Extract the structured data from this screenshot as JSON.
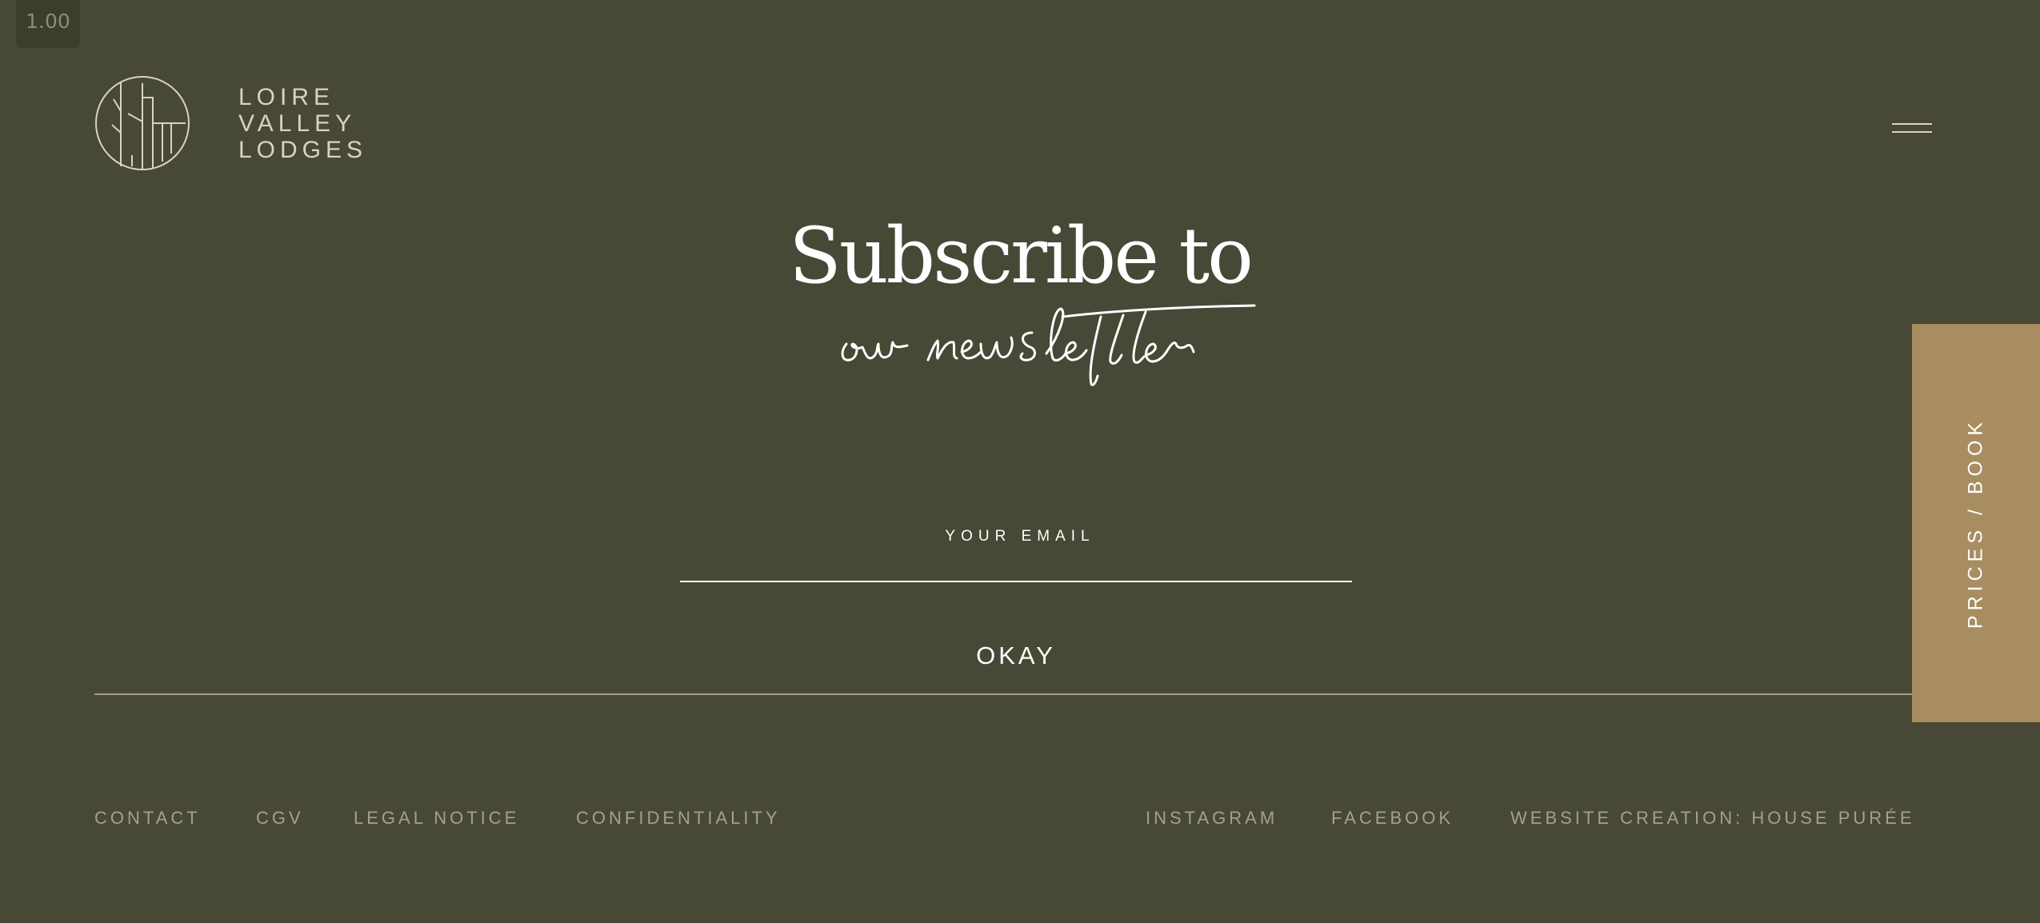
{
  "zoom": "1.00",
  "brand": {
    "lines": [
      "LOIRE",
      "VALLEY",
      "LODGES"
    ]
  },
  "newsletter": {
    "heading": "Subscribe to",
    "script": "our newsletter",
    "email_label": "YOUR EMAIL",
    "email_value": "",
    "submit_label": "OKAY"
  },
  "book_tab": {
    "label": "PRICES / BOOK"
  },
  "footer": {
    "left_links": [
      "CONTACT",
      "CGV",
      "LEGAL NOTICE",
      "CONFIDENTIALITY"
    ],
    "right_links": [
      "INSTAGRAM",
      "FACEBOOK",
      "WEBSITE CREATION: HOUSE PURÉE"
    ]
  },
  "colors": {
    "background": "#474835",
    "accent": "#a88d61",
    "text_light": "#ffffff",
    "text_muted": "#a3a18b"
  },
  "icons": {
    "logo": "tree-circle-logo-icon",
    "menu": "hamburger-menu-icon"
  }
}
